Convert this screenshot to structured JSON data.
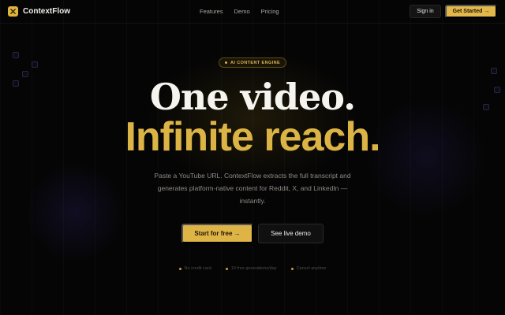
{
  "brand": {
    "name": "ContextFlow",
    "accent": "#e0b43c"
  },
  "nav": {
    "links": [
      "Features",
      "Demo",
      "Pricing"
    ],
    "signin_label": "Sign in",
    "get_started_label": "Get Started →"
  },
  "hero": {
    "badge": "AI CONTENT ENGINE",
    "title_line1": "One video.",
    "title_line2": "Infinite reach.",
    "lede": "Paste a YouTube URL. ContextFlow extracts the full transcript and generates platform-native content for Reddit, X, and LinkedIn — instantly.",
    "primary_cta": "Start for free →",
    "secondary_cta": "See live demo",
    "perks": [
      "No credit card",
      "10 free generations/day",
      "Cancel anytime"
    ]
  }
}
